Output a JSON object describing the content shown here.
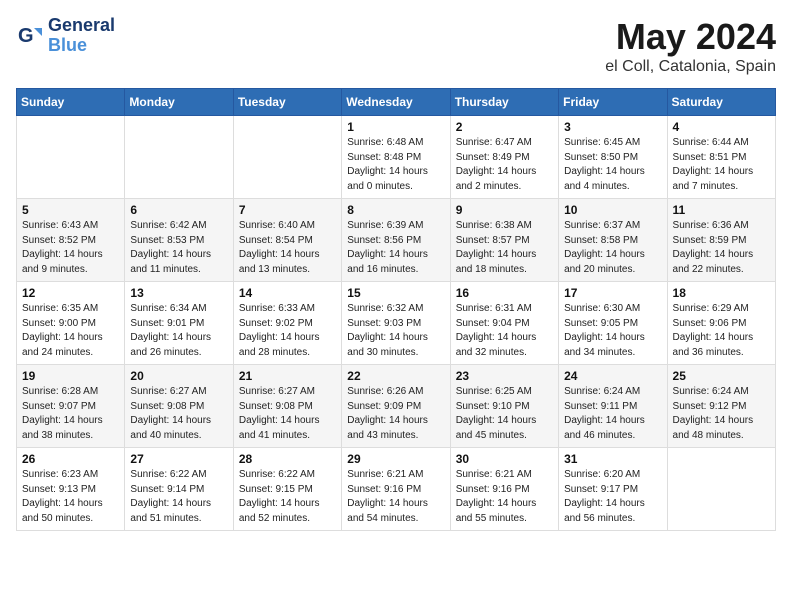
{
  "header": {
    "logo_line1": "General",
    "logo_line2": "Blue",
    "month_year": "May 2024",
    "location": "el Coll, Catalonia, Spain"
  },
  "weekdays": [
    "Sunday",
    "Monday",
    "Tuesday",
    "Wednesday",
    "Thursday",
    "Friday",
    "Saturday"
  ],
  "weeks": [
    [
      {
        "day": "",
        "info": ""
      },
      {
        "day": "",
        "info": ""
      },
      {
        "day": "",
        "info": ""
      },
      {
        "day": "1",
        "info": "Sunrise: 6:48 AM\nSunset: 8:48 PM\nDaylight: 14 hours\nand 0 minutes."
      },
      {
        "day": "2",
        "info": "Sunrise: 6:47 AM\nSunset: 8:49 PM\nDaylight: 14 hours\nand 2 minutes."
      },
      {
        "day": "3",
        "info": "Sunrise: 6:45 AM\nSunset: 8:50 PM\nDaylight: 14 hours\nand 4 minutes."
      },
      {
        "day": "4",
        "info": "Sunrise: 6:44 AM\nSunset: 8:51 PM\nDaylight: 14 hours\nand 7 minutes."
      }
    ],
    [
      {
        "day": "5",
        "info": "Sunrise: 6:43 AM\nSunset: 8:52 PM\nDaylight: 14 hours\nand 9 minutes."
      },
      {
        "day": "6",
        "info": "Sunrise: 6:42 AM\nSunset: 8:53 PM\nDaylight: 14 hours\nand 11 minutes."
      },
      {
        "day": "7",
        "info": "Sunrise: 6:40 AM\nSunset: 8:54 PM\nDaylight: 14 hours\nand 13 minutes."
      },
      {
        "day": "8",
        "info": "Sunrise: 6:39 AM\nSunset: 8:56 PM\nDaylight: 14 hours\nand 16 minutes."
      },
      {
        "day": "9",
        "info": "Sunrise: 6:38 AM\nSunset: 8:57 PM\nDaylight: 14 hours\nand 18 minutes."
      },
      {
        "day": "10",
        "info": "Sunrise: 6:37 AM\nSunset: 8:58 PM\nDaylight: 14 hours\nand 20 minutes."
      },
      {
        "day": "11",
        "info": "Sunrise: 6:36 AM\nSunset: 8:59 PM\nDaylight: 14 hours\nand 22 minutes."
      }
    ],
    [
      {
        "day": "12",
        "info": "Sunrise: 6:35 AM\nSunset: 9:00 PM\nDaylight: 14 hours\nand 24 minutes."
      },
      {
        "day": "13",
        "info": "Sunrise: 6:34 AM\nSunset: 9:01 PM\nDaylight: 14 hours\nand 26 minutes."
      },
      {
        "day": "14",
        "info": "Sunrise: 6:33 AM\nSunset: 9:02 PM\nDaylight: 14 hours\nand 28 minutes."
      },
      {
        "day": "15",
        "info": "Sunrise: 6:32 AM\nSunset: 9:03 PM\nDaylight: 14 hours\nand 30 minutes."
      },
      {
        "day": "16",
        "info": "Sunrise: 6:31 AM\nSunset: 9:04 PM\nDaylight: 14 hours\nand 32 minutes."
      },
      {
        "day": "17",
        "info": "Sunrise: 6:30 AM\nSunset: 9:05 PM\nDaylight: 14 hours\nand 34 minutes."
      },
      {
        "day": "18",
        "info": "Sunrise: 6:29 AM\nSunset: 9:06 PM\nDaylight: 14 hours\nand 36 minutes."
      }
    ],
    [
      {
        "day": "19",
        "info": "Sunrise: 6:28 AM\nSunset: 9:07 PM\nDaylight: 14 hours\nand 38 minutes."
      },
      {
        "day": "20",
        "info": "Sunrise: 6:27 AM\nSunset: 9:08 PM\nDaylight: 14 hours\nand 40 minutes."
      },
      {
        "day": "21",
        "info": "Sunrise: 6:27 AM\nSunset: 9:08 PM\nDaylight: 14 hours\nand 41 minutes."
      },
      {
        "day": "22",
        "info": "Sunrise: 6:26 AM\nSunset: 9:09 PM\nDaylight: 14 hours\nand 43 minutes."
      },
      {
        "day": "23",
        "info": "Sunrise: 6:25 AM\nSunset: 9:10 PM\nDaylight: 14 hours\nand 45 minutes."
      },
      {
        "day": "24",
        "info": "Sunrise: 6:24 AM\nSunset: 9:11 PM\nDaylight: 14 hours\nand 46 minutes."
      },
      {
        "day": "25",
        "info": "Sunrise: 6:24 AM\nSunset: 9:12 PM\nDaylight: 14 hours\nand 48 minutes."
      }
    ],
    [
      {
        "day": "26",
        "info": "Sunrise: 6:23 AM\nSunset: 9:13 PM\nDaylight: 14 hours\nand 50 minutes."
      },
      {
        "day": "27",
        "info": "Sunrise: 6:22 AM\nSunset: 9:14 PM\nDaylight: 14 hours\nand 51 minutes."
      },
      {
        "day": "28",
        "info": "Sunrise: 6:22 AM\nSunset: 9:15 PM\nDaylight: 14 hours\nand 52 minutes."
      },
      {
        "day": "29",
        "info": "Sunrise: 6:21 AM\nSunset: 9:16 PM\nDaylight: 14 hours\nand 54 minutes."
      },
      {
        "day": "30",
        "info": "Sunrise: 6:21 AM\nSunset: 9:16 PM\nDaylight: 14 hours\nand 55 minutes."
      },
      {
        "day": "31",
        "info": "Sunrise: 6:20 AM\nSunset: 9:17 PM\nDaylight: 14 hours\nand 56 minutes."
      },
      {
        "day": "",
        "info": ""
      }
    ]
  ]
}
